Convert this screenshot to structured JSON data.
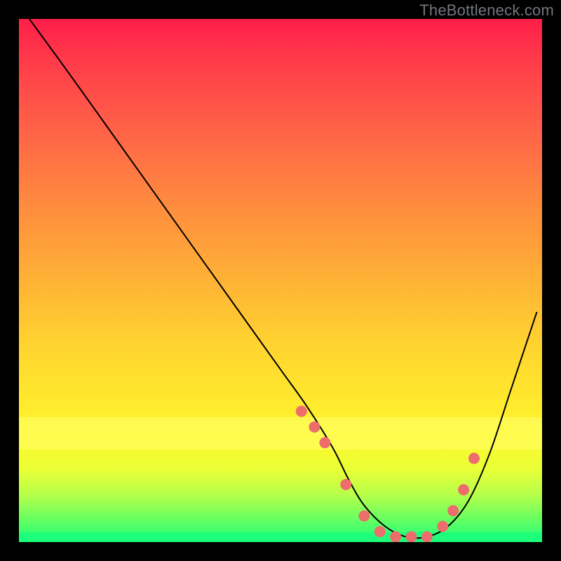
{
  "watermark": "TheBottleneck.com",
  "chart_data": {
    "type": "line",
    "title": "",
    "xlabel": "",
    "ylabel": "",
    "xlim": [
      0,
      100
    ],
    "ylim": [
      0,
      100
    ],
    "grid": false,
    "legend": false,
    "series": [
      {
        "name": "bottleneck-curve",
        "x": [
          2,
          10,
          20,
          30,
          40,
          50,
          55,
          60,
          63,
          66,
          70,
          74,
          78,
          82,
          86,
          90,
          94,
          99
        ],
        "y": [
          100,
          89,
          75,
          61,
          47,
          33,
          26,
          18,
          12,
          7,
          3,
          1,
          1,
          3,
          8,
          17,
          29,
          44
        ],
        "stroke": "#000000",
        "width": 2
      }
    ],
    "markers": {
      "name": "range-points",
      "color": "#ed6d6d",
      "radius": 8,
      "x": [
        54,
        56.5,
        58.5,
        62.5,
        66,
        69,
        72,
        75,
        78,
        81,
        83,
        85,
        87
      ],
      "y": [
        25,
        22,
        19,
        11,
        5,
        2,
        1,
        1,
        1,
        3,
        6,
        10,
        16
      ]
    },
    "background_gradient": {
      "top": "#ff1e49",
      "bottom": "#1dff7b"
    }
  }
}
